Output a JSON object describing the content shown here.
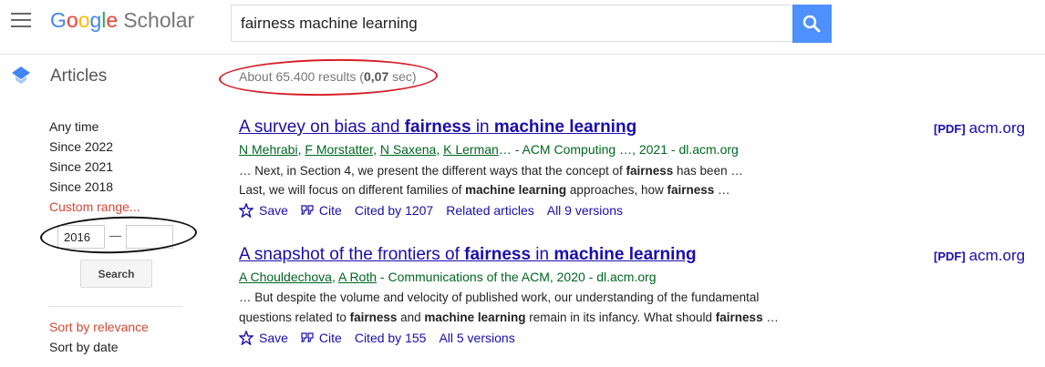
{
  "header": {
    "logo": {
      "google": "Google",
      "scholar": "Scholar"
    },
    "search": {
      "value": "fairness machine learning"
    },
    "section_label": "Articles",
    "result_stats": {
      "prefix": "About 65.400 results (",
      "time": "0,07",
      "suffix": " sec)"
    }
  },
  "sidebar": {
    "time_filters": [
      "Any time",
      "Since 2022",
      "Since 2021",
      "Since 2018",
      "Custom range..."
    ],
    "custom_range": {
      "from": "2016",
      "to": "",
      "dash": "—"
    },
    "search_button": "Search",
    "sort_options": [
      "Sort by relevance",
      "Sort by date"
    ]
  },
  "results": [
    {
      "title_parts": [
        "A survey on bias and ",
        "fairness",
        " in ",
        "machine learning"
      ],
      "authors": [
        "N Mehrabi",
        "F Morstatter",
        "N Saxena",
        "K Lerman"
      ],
      "source": "… - ACM Computing …, 2021 - dl.acm.org",
      "snippet1": [
        "… Next, in Section 4, we present the different ways that the concept of ",
        "fairness",
        " has been …"
      ],
      "snippet2": [
        "Last, we will focus on different families of ",
        "machine learning",
        " approaches, how ",
        "fairness",
        " …"
      ],
      "actions": {
        "save": "Save",
        "cite": "Cite",
        "cited_by": "Cited by 1207",
        "related": "Related articles",
        "versions": "All 9 versions"
      },
      "pdf": {
        "tag": "[PDF]",
        "domain": "acm.org"
      }
    },
    {
      "title_parts": [
        "A snapshot of the frontiers of ",
        "fairness",
        " in ",
        "machine learning"
      ],
      "authors": [
        "A Chouldechova",
        "A Roth"
      ],
      "source": " - Communications of the ACM, 2020 - dl.acm.org",
      "snippet1": [
        "… But despite the volume and velocity of published work, our understanding of the fundamental"
      ],
      "snippet2": [
        "questions related to ",
        "fairness",
        " and ",
        "machine learning",
        " remain in its infancy. What should ",
        "fairness",
        " …"
      ],
      "actions": {
        "save": "Save",
        "cite": "Cite",
        "cited_by": "Cited by 155",
        "versions": "All 5 versions"
      },
      "pdf": {
        "tag": "[PDF]",
        "domain": "acm.org"
      }
    }
  ],
  "colors": {
    "link": "#1a0dab",
    "author_green": "#006621",
    "accent_red": "#d14836",
    "search_blue": "#4d90fe"
  }
}
